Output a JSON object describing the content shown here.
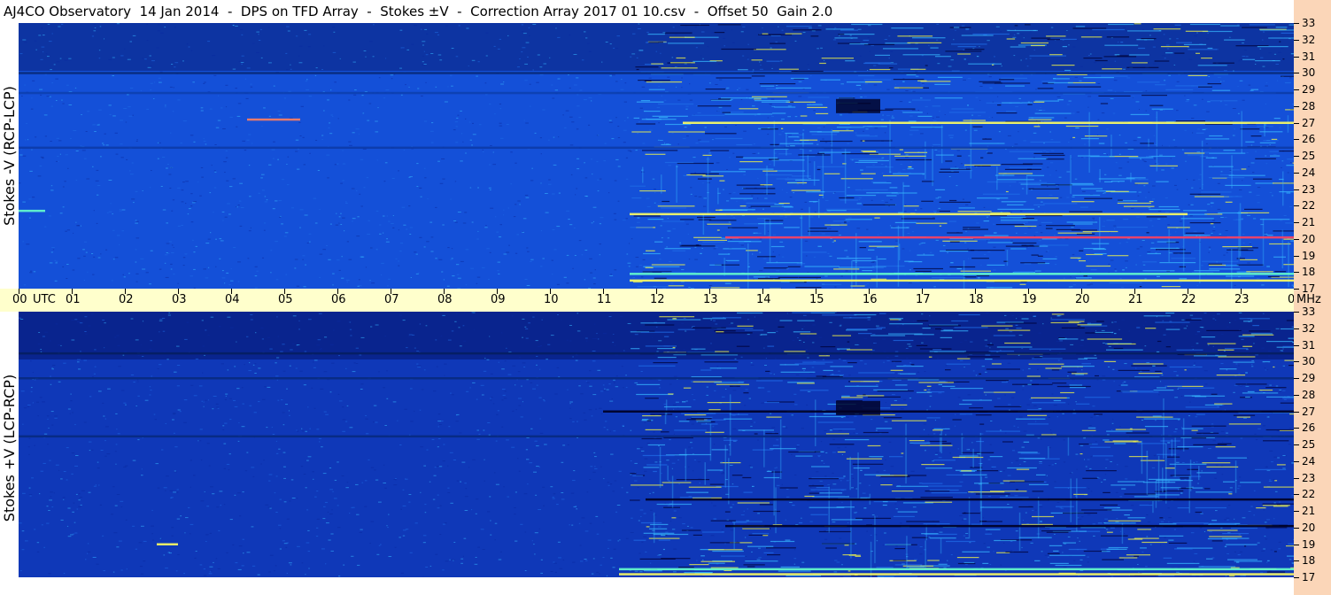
{
  "chart_data": {
    "type": "heatmap",
    "title": "AJ4CO Observatory  14 Jan 2014  -  DPS on TFD Array  -  Stokes ±V  -  Correction Array 2017 01 10.csv  -  Offset 50  Gain 2.0",
    "x": {
      "tick_labels": [
        "00",
        "01",
        "02",
        "03",
        "04",
        "05",
        "06",
        "07",
        "08",
        "09",
        "10",
        "11",
        "12",
        "13",
        "14",
        "15",
        "16",
        "17",
        "18",
        "19",
        "20",
        "21",
        "22",
        "23",
        "00"
      ],
      "unit_left": "UTC",
      "unit_right": "MHz",
      "range": [
        0,
        24
      ]
    },
    "y": {
      "tick_labels": [
        "17",
        "18",
        "19",
        "20",
        "21",
        "22",
        "23",
        "24",
        "25",
        "26",
        "27",
        "28",
        "29",
        "30",
        "31",
        "32",
        "33"
      ],
      "range": [
        17,
        33
      ]
    },
    "colormap": [
      "#000033",
      "#0a2aa0",
      "#1f6ee8",
      "#37b8ff",
      "#ffff40",
      "#ff3040"
    ],
    "panels": [
      {
        "ylabel": "Stokes -V (RCP-LCP)",
        "base_color": "#1450d8",
        "activity_start_utc": 11.5,
        "features": [
          {
            "type": "band",
            "mhz": 30.0,
            "color": "#082a7a"
          },
          {
            "type": "band",
            "mhz": 28.8,
            "color": "#0c3fb0"
          },
          {
            "type": "band",
            "mhz": 25.5,
            "color": "#0c3aa8"
          },
          {
            "type": "band",
            "mhz": 20.1,
            "from": 13.3,
            "to": 24,
            "color": "#ff4060"
          },
          {
            "type": "band",
            "mhz": 21.5,
            "from": 11.5,
            "to": 22,
            "color": "#ffff60"
          },
          {
            "type": "band",
            "mhz": 27.0,
            "from": 12.5,
            "to": 24,
            "color": "#ffff60"
          },
          {
            "type": "band",
            "mhz": 17.9,
            "from": 11.5,
            "to": 24,
            "color": "#66ffcc"
          },
          {
            "type": "band",
            "mhz": 17.5,
            "from": 11.5,
            "to": 24,
            "color": "#ffff60"
          },
          {
            "type": "band",
            "mhz": 27.2,
            "from": 4.3,
            "to": 5.3,
            "color": "#ff8060"
          },
          {
            "type": "band",
            "mhz": 21.7,
            "from": 0.0,
            "to": 0.5,
            "color": "#66ffcc"
          },
          {
            "type": "patch",
            "utc": 15.8,
            "mhz": 28.0,
            "color": "#000022"
          }
        ]
      },
      {
        "ylabel": "Stokes +V (LCP-RCP)",
        "base_color": "#0f38b8",
        "activity_start_utc": 11.5,
        "features": [
          {
            "type": "band",
            "mhz": 30.5,
            "color": "#061e60"
          },
          {
            "type": "band",
            "mhz": 29.0,
            "color": "#082a80"
          },
          {
            "type": "band",
            "mhz": 25.5,
            "color": "#082a80"
          },
          {
            "type": "band",
            "mhz": 20.1,
            "from": 13.3,
            "to": 24,
            "color": "#000022"
          },
          {
            "type": "band",
            "mhz": 21.7,
            "from": 11.8,
            "to": 24,
            "color": "#000022"
          },
          {
            "type": "band",
            "mhz": 27.0,
            "from": 11.0,
            "to": 24,
            "color": "#000022"
          },
          {
            "type": "band",
            "mhz": 17.5,
            "from": 11.3,
            "to": 24,
            "color": "#66ffcc"
          },
          {
            "type": "band",
            "mhz": 17.2,
            "from": 11.3,
            "to": 24,
            "color": "#ffff60"
          },
          {
            "type": "band",
            "mhz": 19.0,
            "from": 2.6,
            "to": 3.0,
            "color": "#ffff60"
          },
          {
            "type": "patch",
            "utc": 15.8,
            "mhz": 27.2,
            "color": "#000022"
          }
        ]
      }
    ]
  }
}
